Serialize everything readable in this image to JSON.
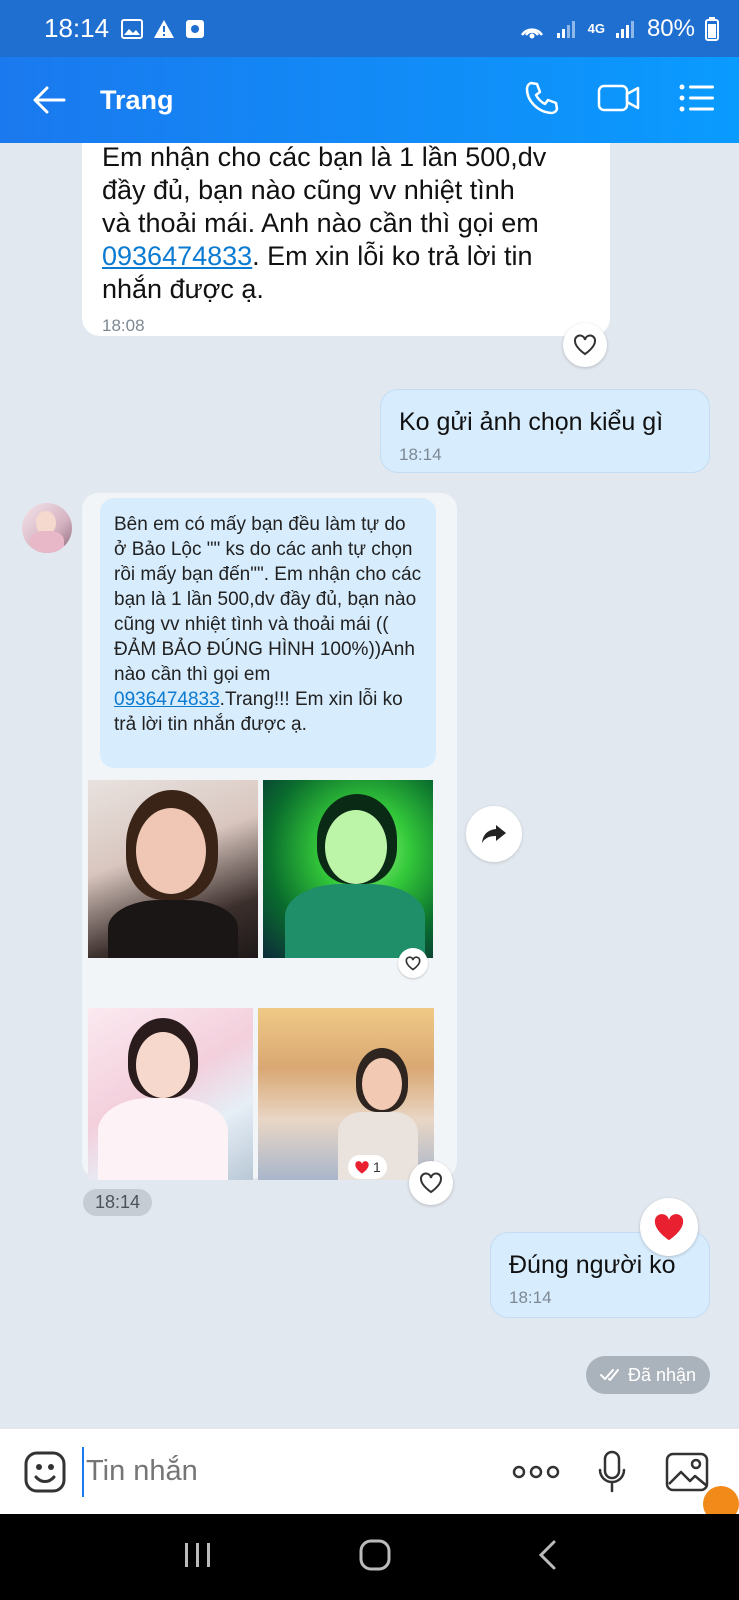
{
  "status_bar": {
    "time": "18:14",
    "network": "4G",
    "battery": "80%"
  },
  "header": {
    "contact_name": "Trang"
  },
  "messages": [
    {
      "lines": [
        "Em nhận cho các bạn là 1 lần 500,dv",
        "đầy đủ, bạn nào cũng vv nhiệt tình",
        "và thoải mái. Anh nào cần thì gọi em"
      ],
      "phone": "0936474833",
      "after_phone": ". Em xin lỗi ko trả lời tin",
      "last_line": "nhắn được ạ.",
      "time": "18:08"
    },
    {
      "text": "Ko gửi ảnh chọn kiểu gì",
      "time": "18:14"
    },
    {
      "text_before": "Bên em có mấy bạn đều làm tự do ở Bảo Lộc \"\" ks do các anh tự chọn rồi mấy bạn đến\"\". Em nhận cho các bạn là 1 lần 500,dv đầy đủ, bạn nào cũng vv nhiệt tình và thoải mái (( ĐẢM BẢO ĐÚNG HÌNH 100%))Anh nào cần thì gọi em ",
      "phone": "0936474833",
      "text_after": ".Trang!!! Em xin lỗi ko trả lời tin nhắn được ạ.",
      "reaction_count": "1",
      "time": "18:14"
    },
    {
      "text": "Đúng người ko",
      "time": "18:14",
      "status": "Đã nhận"
    }
  ],
  "input": {
    "placeholder": "Tin nhắn"
  },
  "colors": {
    "header_blue": "#1a79ee",
    "link": "#0b7ad1",
    "outgoing_bubble": "#d7ecfd",
    "heart_red": "#e8202f"
  }
}
